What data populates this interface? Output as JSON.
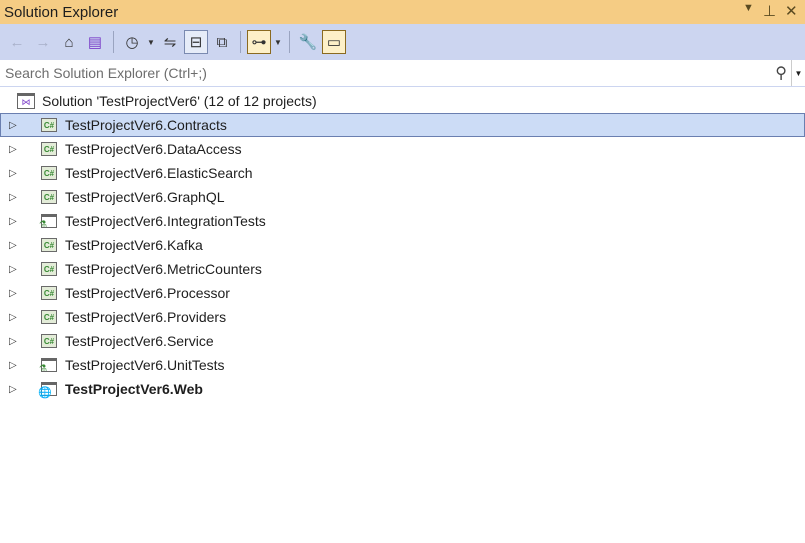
{
  "title": "Solution Explorer",
  "window_controls": {
    "dropdown": "▾",
    "pin": "📌",
    "close": "✕"
  },
  "toolbar": {
    "back": "⊖",
    "forward": "⊖",
    "home": "⌂",
    "switch_views": "▤",
    "pending_changes": "◷",
    "sync": "⇋",
    "collapse_all": "⊟",
    "show_all": "⧉",
    "class_view": "⊶",
    "properties": "🔧",
    "preview": "▭"
  },
  "search": {
    "placeholder": "Search Solution Explorer (Ctrl+;)"
  },
  "solution": {
    "label": "Solution 'TestProjectVer6' (12 of 12 projects)"
  },
  "projects": [
    {
      "label": "TestProjectVer6.Contracts",
      "type": "csharp",
      "selected": true
    },
    {
      "label": "TestProjectVer6.DataAccess",
      "type": "csharp"
    },
    {
      "label": "TestProjectVer6.ElasticSearch",
      "type": "csharp"
    },
    {
      "label": "TestProjectVer6.GraphQL",
      "type": "csharp"
    },
    {
      "label": "TestProjectVer6.IntegrationTests",
      "type": "test"
    },
    {
      "label": "TestProjectVer6.Kafka",
      "type": "csharp"
    },
    {
      "label": "TestProjectVer6.MetricCounters",
      "type": "csharp"
    },
    {
      "label": "TestProjectVer6.Processor",
      "type": "csharp"
    },
    {
      "label": "TestProjectVer6.Providers",
      "type": "csharp"
    },
    {
      "label": "TestProjectVer6.Service",
      "type": "csharp"
    },
    {
      "label": "TestProjectVer6.UnitTests",
      "type": "test"
    },
    {
      "label": "TestProjectVer6.Web",
      "type": "web",
      "bold": true
    }
  ],
  "colors": {
    "title_bg": "#f5cc84",
    "toolbar_bg": "#ccd5f0",
    "selection": "#ccdcf6"
  }
}
